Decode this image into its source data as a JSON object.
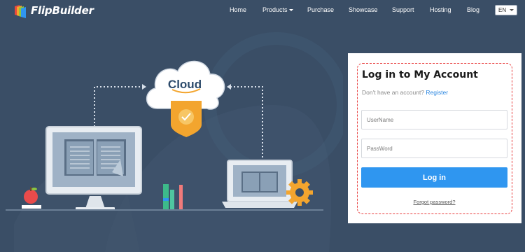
{
  "brand": {
    "name": "FlipBuilder"
  },
  "nav": {
    "items": [
      {
        "label": "Home"
      },
      {
        "label": "Products",
        "has_dropdown": true
      },
      {
        "label": "Purchase"
      },
      {
        "label": "Showcase"
      },
      {
        "label": "Support"
      },
      {
        "label": "Hosting"
      },
      {
        "label": "Blog"
      }
    ],
    "language": "EN"
  },
  "hero": {
    "cloud_label": "Cloud",
    "icons": [
      "cloud-icon",
      "shield-check-icon",
      "desktop-monitor-icon",
      "open-book-icon",
      "laptop-icon",
      "gear-icon",
      "apple-icon",
      "books-icon"
    ]
  },
  "login": {
    "title": "Log in to My Account",
    "no_account_text": "Don't have an account?",
    "register_link": "Register",
    "username_placeholder": "UserName",
    "password_placeholder": "PassWord",
    "login_button": "Log in",
    "forgot_password": "Forgot password?"
  },
  "colors": {
    "background": "#3a4e66",
    "accent_blue": "#2f96f0",
    "dashed_border": "#e83b3b",
    "shield_orange": "#f3a52e"
  }
}
